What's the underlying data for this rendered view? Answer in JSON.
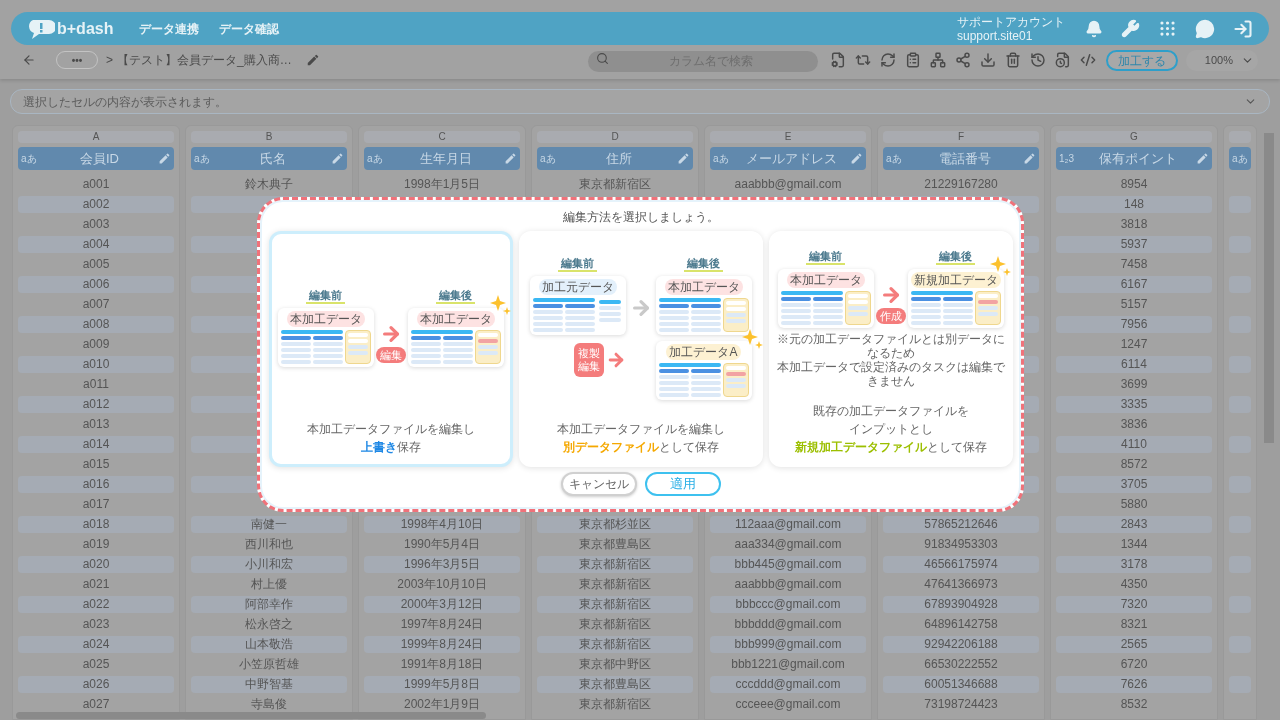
{
  "header": {
    "logo": "b+dash",
    "nav": [
      "データ連携",
      "データ確認"
    ],
    "account": {
      "name": "サポートアカウント",
      "id": "support.site01"
    }
  },
  "toolbar": {
    "more": "•••",
    "separator": ">",
    "breadcrumb": "【テスト】会員データ_購入商…",
    "search": {
      "placeholder": "カラム名で検索"
    },
    "process_button": "加工する",
    "zoom": "100%"
  },
  "cell_bar": {
    "placeholder": "選択したセルの内容が表示されます。"
  },
  "table": {
    "columns": [
      {
        "letter": "A",
        "type_label": "aあ",
        "title": "会員ID"
      },
      {
        "letter": "B",
        "type_label": "aあ",
        "title": "氏名"
      },
      {
        "letter": "C",
        "type_label": "aあ",
        "title": "生年月日"
      },
      {
        "letter": "D",
        "type_label": "aあ",
        "title": "住所"
      },
      {
        "letter": "E",
        "type_label": "aあ",
        "title": "メールアドレス"
      },
      {
        "letter": "F",
        "type_label": "aあ",
        "title": "電話番号"
      },
      {
        "letter": "G",
        "type_label": "1₂3",
        "title": "保有ポイント"
      },
      {
        "type_label": "aあ"
      }
    ],
    "rows": [
      {
        "cells": [
          "a001",
          "鈴木典子",
          "1998年1月5日",
          "東京都新宿区",
          "aaabbb@gmail.com",
          "21229167280",
          "8954"
        ]
      },
      {
        "cells": [
          "a002",
          null,
          null,
          null,
          null,
          null,
          "148"
        ]
      },
      {
        "cells": [
          "a003",
          null,
          null,
          null,
          null,
          null,
          "3818"
        ]
      },
      {
        "cells": [
          "a004",
          null,
          null,
          null,
          null,
          null,
          "5937"
        ]
      },
      {
        "cells": [
          "a005",
          null,
          null,
          null,
          null,
          null,
          "7458"
        ]
      },
      {
        "cells": [
          "a006",
          null,
          null,
          null,
          null,
          null,
          "6167"
        ]
      },
      {
        "cells": [
          "a007",
          null,
          null,
          null,
          null,
          null,
          "5157"
        ]
      },
      {
        "cells": [
          "a008",
          null,
          null,
          null,
          null,
          null,
          "7956"
        ]
      },
      {
        "cells": [
          "a009",
          null,
          null,
          null,
          null,
          null,
          "1247"
        ]
      },
      {
        "cells": [
          "a010",
          null,
          null,
          null,
          null,
          null,
          "6114"
        ]
      },
      {
        "cells": [
          "a011",
          null,
          null,
          null,
          null,
          null,
          "3699"
        ]
      },
      {
        "cells": [
          "a012",
          null,
          null,
          null,
          null,
          null,
          "3335"
        ]
      },
      {
        "cells": [
          "a013",
          null,
          null,
          null,
          null,
          null,
          "3836"
        ]
      },
      {
        "cells": [
          "a014",
          null,
          null,
          null,
          null,
          null,
          "4110"
        ]
      },
      {
        "cells": [
          "a015",
          null,
          null,
          null,
          null,
          null,
          "8572"
        ]
      },
      {
        "cells": [
          "a016",
          null,
          null,
          null,
          null,
          null,
          "3705"
        ]
      },
      {
        "cells": [
          "a017",
          null,
          null,
          null,
          null,
          null,
          "5880"
        ]
      },
      {
        "cells": [
          "a018",
          "南健一",
          "1998年4月10日",
          "東京都杉並区",
          "112aaa@gmail.com",
          "57865212646",
          "2843"
        ]
      },
      {
        "cells": [
          "a019",
          "西川和也",
          "1990年5月4日",
          "東京都豊島区",
          "aaa334@gmail.com",
          "91834953303",
          "1344"
        ]
      },
      {
        "cells": [
          "a020",
          "小川和宏",
          "1996年3月5日",
          "東京都新宿区",
          "bbb445@gmail.com",
          "46566175974",
          "3178"
        ]
      },
      {
        "cells": [
          "a021",
          "村上優",
          "2003年10月10日",
          "東京都新宿区",
          "aaabbb@gmail.com",
          "47641366973",
          "4350"
        ]
      },
      {
        "cells": [
          "a022",
          "阿部幸作",
          "2000年3月12日",
          "東京都新宿区",
          "bbbccc@gmail.com",
          "67893904928",
          "7320"
        ]
      },
      {
        "cells": [
          "a023",
          "松永啓之",
          "1997年8月24日",
          "東京都新宿区",
          "bbbddd@gmail.com",
          "64896142758",
          "8321"
        ]
      },
      {
        "cells": [
          "a024",
          "山本敬浩",
          "1999年8月24日",
          "東京都新宿区",
          "bbb999@gmail.com",
          "92942206188",
          "2565"
        ]
      },
      {
        "cells": [
          "a025",
          "小笠原哲雄",
          "1991年8月18日",
          "東京都中野区",
          "bbb1221@gmail.com",
          "66530222552",
          "6720"
        ]
      },
      {
        "cells": [
          "a026",
          "中野智基",
          "1999年5月8日",
          "東京都豊島区",
          "cccddd@gmail.com",
          "60051346688",
          "7626"
        ]
      },
      {
        "cells": [
          "a027",
          "寺島俊",
          "2002年1月9日",
          "東京都新宿区",
          "ccceee@gmail.com",
          "73198724423",
          "8532"
        ]
      }
    ]
  },
  "dialog": {
    "title": "編集方法を選択しましょう。",
    "options": [
      {
        "selected": true,
        "illustration": {
          "kind": "overwrite",
          "before_label": "編集前",
          "after_label": "編集後",
          "before_table": {
            "tag": "本加工データ",
            "color": "#fde2e2",
            "highlighted": true,
            "edited": false
          },
          "action": "編集",
          "after_table": {
            "tag": "本加工データ",
            "color": "#fde2e2",
            "highlighted": true,
            "edited": true
          }
        },
        "description": [
          [
            {
              "text": "本加工データファイルを編集し"
            }
          ],
          [
            {
              "text": "上書き",
              "color": "#1e88e5"
            },
            {
              "text": "保存"
            }
          ]
        ]
      },
      {
        "selected": false,
        "illustration": {
          "kind": "copy",
          "before_label": "編集前",
          "after_label": "編集後",
          "before_table": {
            "tag": "加工元データ",
            "color": "#e3f0fb",
            "highlighted": false,
            "edited": false
          },
          "action": [
            "複製",
            "編集"
          ],
          "after_table": {
            "tag": "本加工データ",
            "color": "#fde2e2",
            "highlighted": true,
            "edited": false
          },
          "copy_table": {
            "tag": "加工データA",
            "color": "#fdf1d2",
            "highlighted": true,
            "edited": true
          }
        },
        "description": [
          [
            {
              "text": "本加工データファイルを編集し"
            }
          ],
          [
            {
              "text": "別データファイル",
              "color": "#f5a800"
            },
            {
              "text": "として保存"
            }
          ]
        ]
      },
      {
        "selected": false,
        "illustration": {
          "kind": "new",
          "before_label": "編集前",
          "after_label": "編集後",
          "before_table": {
            "tag": "本加工データ",
            "color": "#fde2e2",
            "highlighted": true,
            "edited": false
          },
          "action": "作成",
          "after_table": {
            "tag": "新規加工データ",
            "color": "#fdf1d2",
            "highlighted": true,
            "edited": true
          },
          "note": [
            "※元の加工データファイルとは別データになるため",
            "本加工データで設定済みのタスクは編集できません"
          ]
        },
        "description": [
          [
            {
              "text": "既存の加工データファイルを"
            }
          ],
          [
            {
              "text": "インプットとし"
            }
          ],
          [
            {
              "text": "新規加工データファイル",
              "color": "#9cbf00"
            },
            {
              "text": "として保存"
            }
          ]
        ]
      }
    ],
    "buttons": [
      {
        "label": "キャンセル",
        "kind": "secondary"
      },
      {
        "label": "適用",
        "kind": "primary"
      }
    ]
  }
}
